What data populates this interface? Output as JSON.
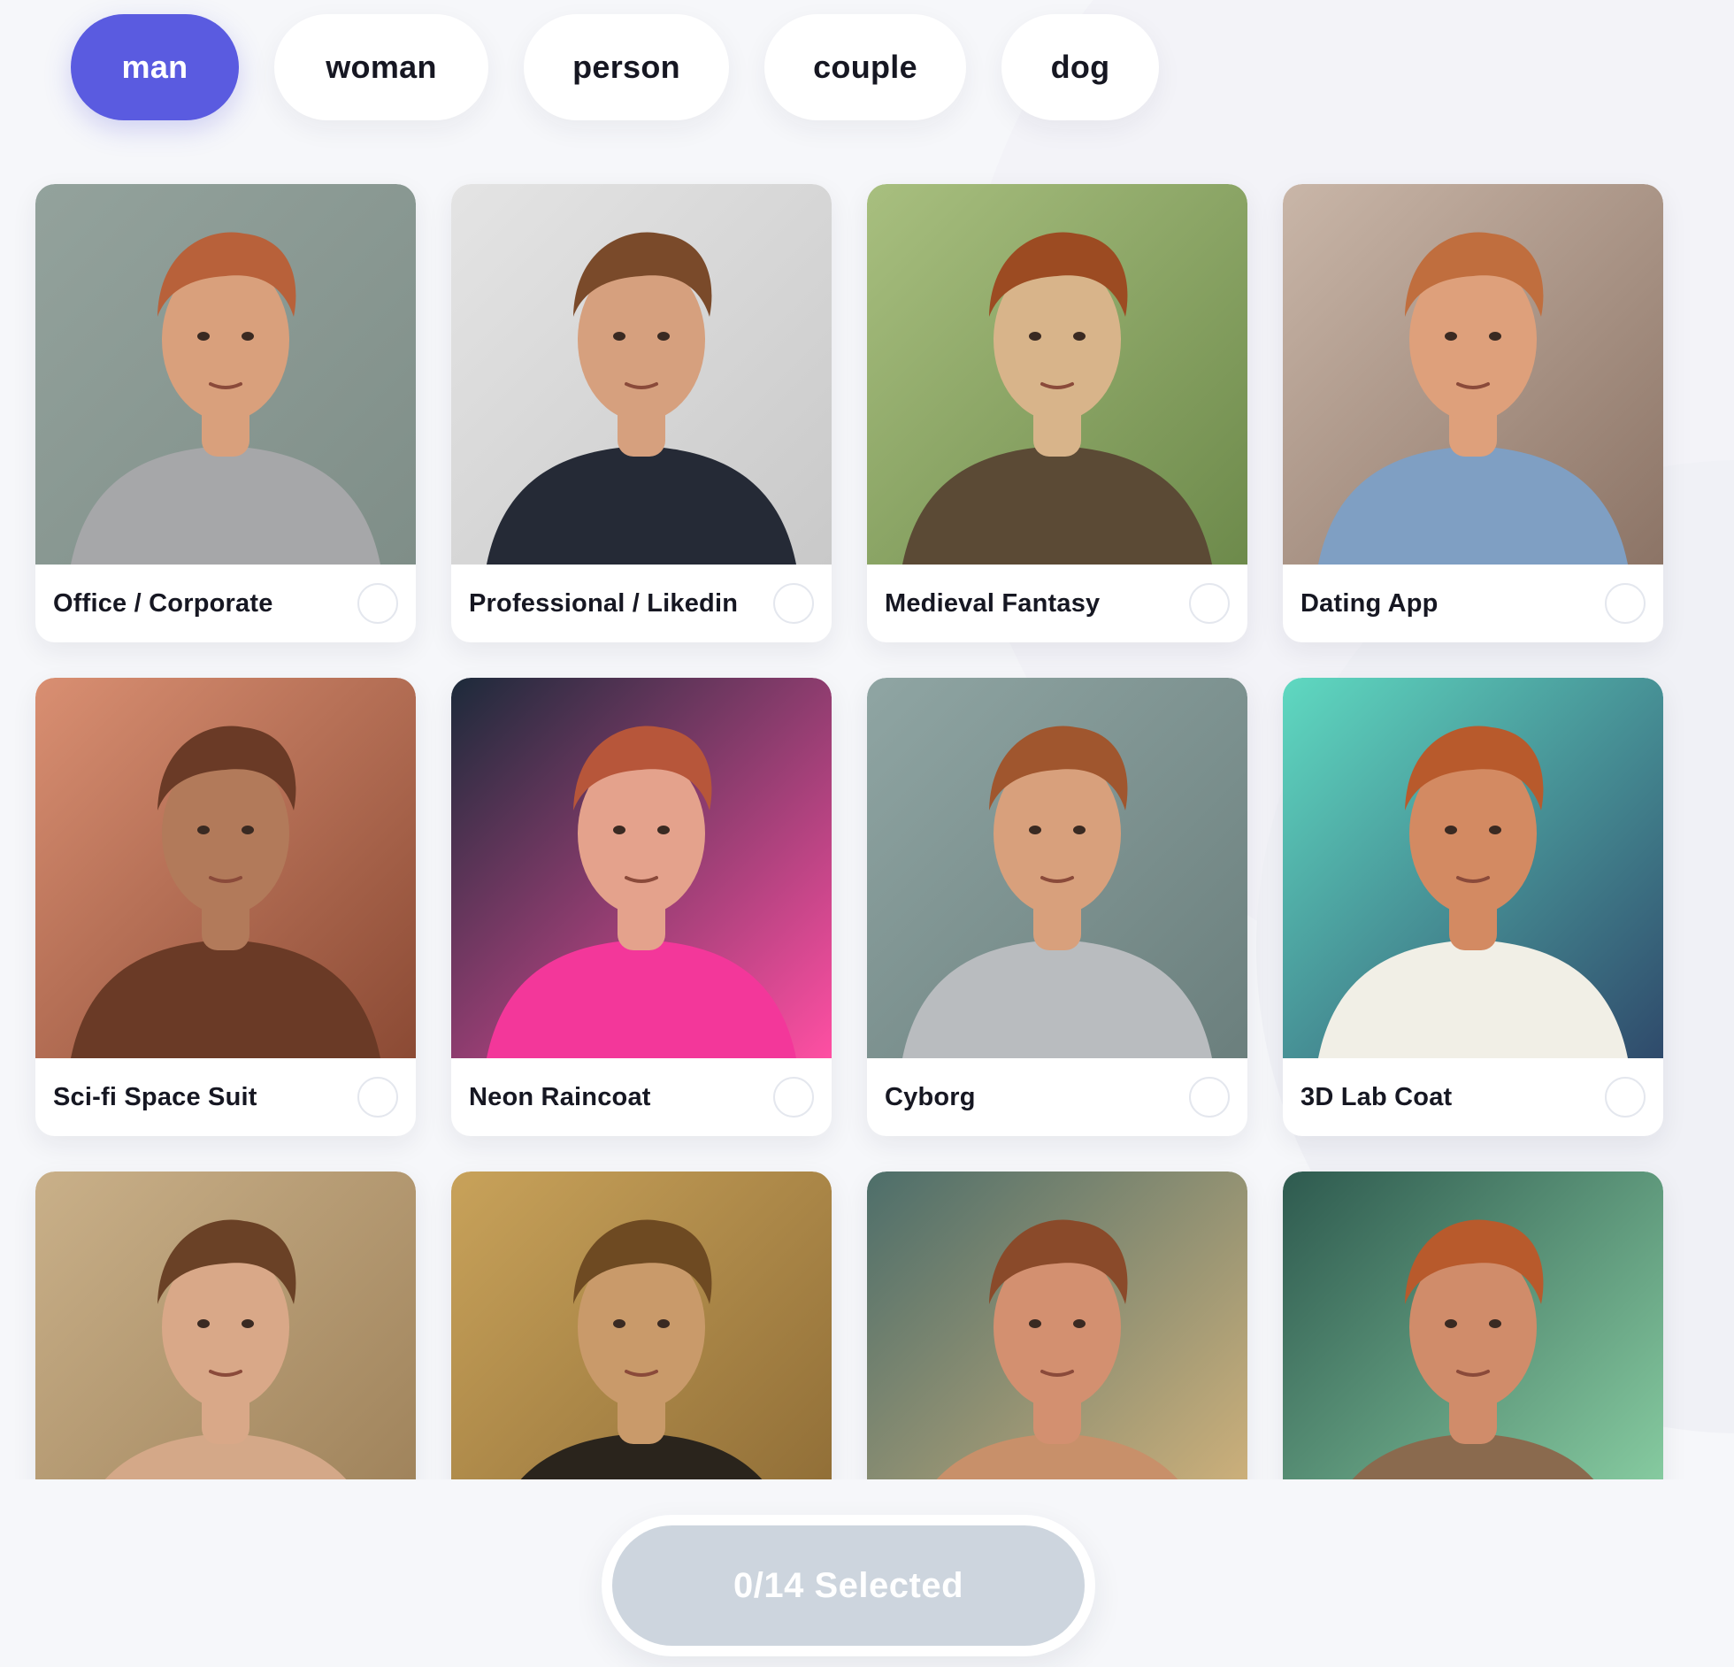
{
  "categories": [
    {
      "label": "man",
      "active": true
    },
    {
      "label": "woman",
      "active": false
    },
    {
      "label": "person",
      "active": false
    },
    {
      "label": "couple",
      "active": false
    },
    {
      "label": "dog",
      "active": false
    }
  ],
  "styles": [
    {
      "label": "Office / Corporate",
      "selected": false,
      "palette": {
        "bg": "#93a29c",
        "bg2": "#7f8e88",
        "shirt": "#a6a7a9",
        "skin": "#d9a07c",
        "hair": "#b8613a"
      }
    },
    {
      "label": "Professional / Likedin",
      "selected": false,
      "palette": {
        "bg": "#e4e4e4",
        "bg2": "#c9c9c9",
        "shirt": "#252a36",
        "skin": "#d6a07e",
        "hair": "#7a4a2a"
      }
    },
    {
      "label": "Medieval Fantasy",
      "selected": false,
      "palette": {
        "bg": "#a8bf7f",
        "bg2": "#6d8a4b",
        "shirt": "#5b4a35",
        "skin": "#d8b48a",
        "hair": "#9c4b22"
      }
    },
    {
      "label": "Dating App",
      "selected": false,
      "palette": {
        "bg": "#c9b6a8",
        "bg2": "#8c7466",
        "shirt": "#7f9fc3",
        "skin": "#dea07b",
        "hair": "#c06e3e"
      }
    },
    {
      "label": "Sci-fi Space Suit",
      "selected": false,
      "palette": {
        "bg": "#d98f72",
        "bg2": "#8b4a34",
        "shirt": "#6a3a26",
        "skin": "#b27a5a",
        "hair": "#6a3a26"
      }
    },
    {
      "label": "Neon Raincoat",
      "selected": false,
      "palette": {
        "bg": "#1c2a3a",
        "bg2": "#ff4fa3",
        "shirt": "#f3379a",
        "skin": "#e4a28c",
        "hair": "#b7563a"
      }
    },
    {
      "label": "Cyborg",
      "selected": false,
      "palette": {
        "bg": "#8fa5a3",
        "bg2": "#6b7f7d",
        "shirt": "#b9bcbf",
        "skin": "#d8a07c",
        "hair": "#a0562e"
      }
    },
    {
      "label": "3D Lab Coat",
      "selected": false,
      "palette": {
        "bg": "#5fd9c1",
        "bg2": "#2f4a6b",
        "shirt": "#f1efe6",
        "skin": "#d38a62",
        "hair": "#b85a2c"
      }
    },
    {
      "label": "",
      "selected": false,
      "palette": {
        "bg": "#c9b089",
        "bg2": "#9c7f57",
        "shirt": "#d4a888",
        "skin": "#d9a888",
        "hair": "#6a4126"
      }
    },
    {
      "label": "",
      "selected": false,
      "palette": {
        "bg": "#c8a25a",
        "bg2": "#8c6a34",
        "shirt": "#2a241c",
        "skin": "#c99a6a",
        "hair": "#6e4a22"
      }
    },
    {
      "label": "",
      "selected": false,
      "palette": {
        "bg": "#4d6e6a",
        "bg2": "#d9b67c",
        "shirt": "#c8906a",
        "skin": "#d39070",
        "hair": "#8a4a2a"
      }
    },
    {
      "label": "",
      "selected": false,
      "palette": {
        "bg": "#2e5a4f",
        "bg2": "#8fd6a8",
        "shirt": "#8a6a4e",
        "skin": "#d08c6a",
        "hair": "#b85a2c"
      }
    }
  ],
  "selection": {
    "label": "0/14 Selected",
    "selected_count": 0,
    "total": 14
  }
}
